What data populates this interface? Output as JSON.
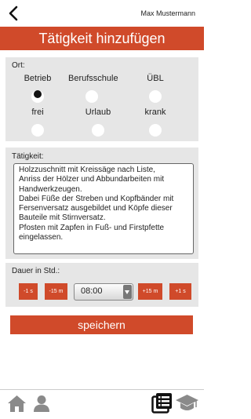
{
  "header": {
    "user_name": "Max Mustermann",
    "title": "Tätigkeit hinzufügen"
  },
  "ort": {
    "label": "Ort:",
    "options": [
      {
        "label": "Betrieb",
        "selected": true
      },
      {
        "label": "Berufsschule",
        "selected": false
      },
      {
        "label": "ÜBL",
        "selected": false
      },
      {
        "label": "frei",
        "selected": false
      },
      {
        "label": "Urlaub",
        "selected": false
      },
      {
        "label": "krank",
        "selected": false
      }
    ]
  },
  "taetigkeit": {
    "label": "Tätigkeit:",
    "text": "Holzzuschnitt mit Kreissäge nach Liste,\nAnriss der Hölzer und Abbundarbeiten mit Handwerkzeugen.\nDabei Füße der Streben und Kopfbänder mit Fersenversatz ausgebildet und Köpfe dieser Bauteile mit Stirnversatz.\nPfosten mit Zapfen in Fuß- und Firstpfette eingelassen."
  },
  "dauer": {
    "label": "Dauer in Std.:",
    "minus_1s": "-1 s",
    "minus_15m": "-15 m",
    "selected_time": "08:00",
    "plus_15m": "+15 m",
    "plus_1s": "+1 s"
  },
  "save_label": "speichern",
  "colors": {
    "accent": "#d04a2a",
    "panel": "#e6e6e6"
  },
  "nav": {
    "icons": [
      "home-icon",
      "person-icon",
      "list-icon",
      "graduation-cap-icon"
    ]
  }
}
